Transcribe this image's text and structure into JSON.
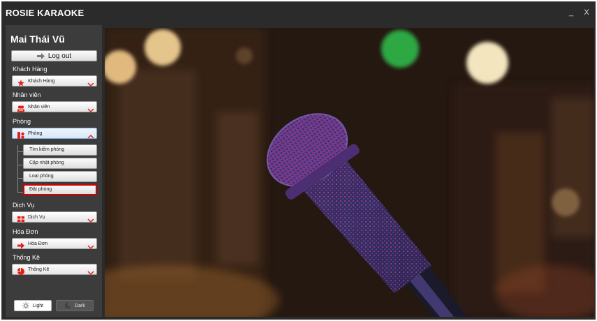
{
  "window": {
    "title": "ROSIE KARAOKE",
    "minimize_label": "_",
    "close_label": "X"
  },
  "sidebar": {
    "user_name": "Mai Thái Vũ",
    "logout_label": "Log out",
    "sections": [
      {
        "label": "Khách Hàng",
        "value": "Khách Hàng",
        "icon": "star-icon"
      },
      {
        "label": "Nhân viên",
        "value": "Nhân viên",
        "icon": "employee-icon"
      },
      {
        "label": "Phòng",
        "value": "Phòng",
        "icon": "room-icon"
      },
      {
        "label": "Dịch Vụ",
        "value": "Dịch Vụ",
        "icon": "service-icon"
      },
      {
        "label": "Hóa Đơn",
        "value": "Hóa Đơn",
        "icon": "invoice-icon"
      },
      {
        "label": "Thống Kê",
        "value": "Thống Kê",
        "icon": "pie-chart-icon"
      }
    ],
    "room_submenu": [
      "Tìm kiếm phòng",
      "Cập nhật phòng",
      "Loại phòng",
      "Đặt phòng"
    ],
    "selected_submenu": "Đặt phòng",
    "theme": {
      "light_label": "Light",
      "dark_label": "Dark",
      "current": "Light"
    }
  },
  "main": {
    "image": "microphone-background-photo"
  },
  "colors": {
    "accent_red": "#e0201b",
    "sidebar_bg": "#3c3c3c",
    "window_bg": "#2b2b2b",
    "selected_outline": "#d10000"
  }
}
